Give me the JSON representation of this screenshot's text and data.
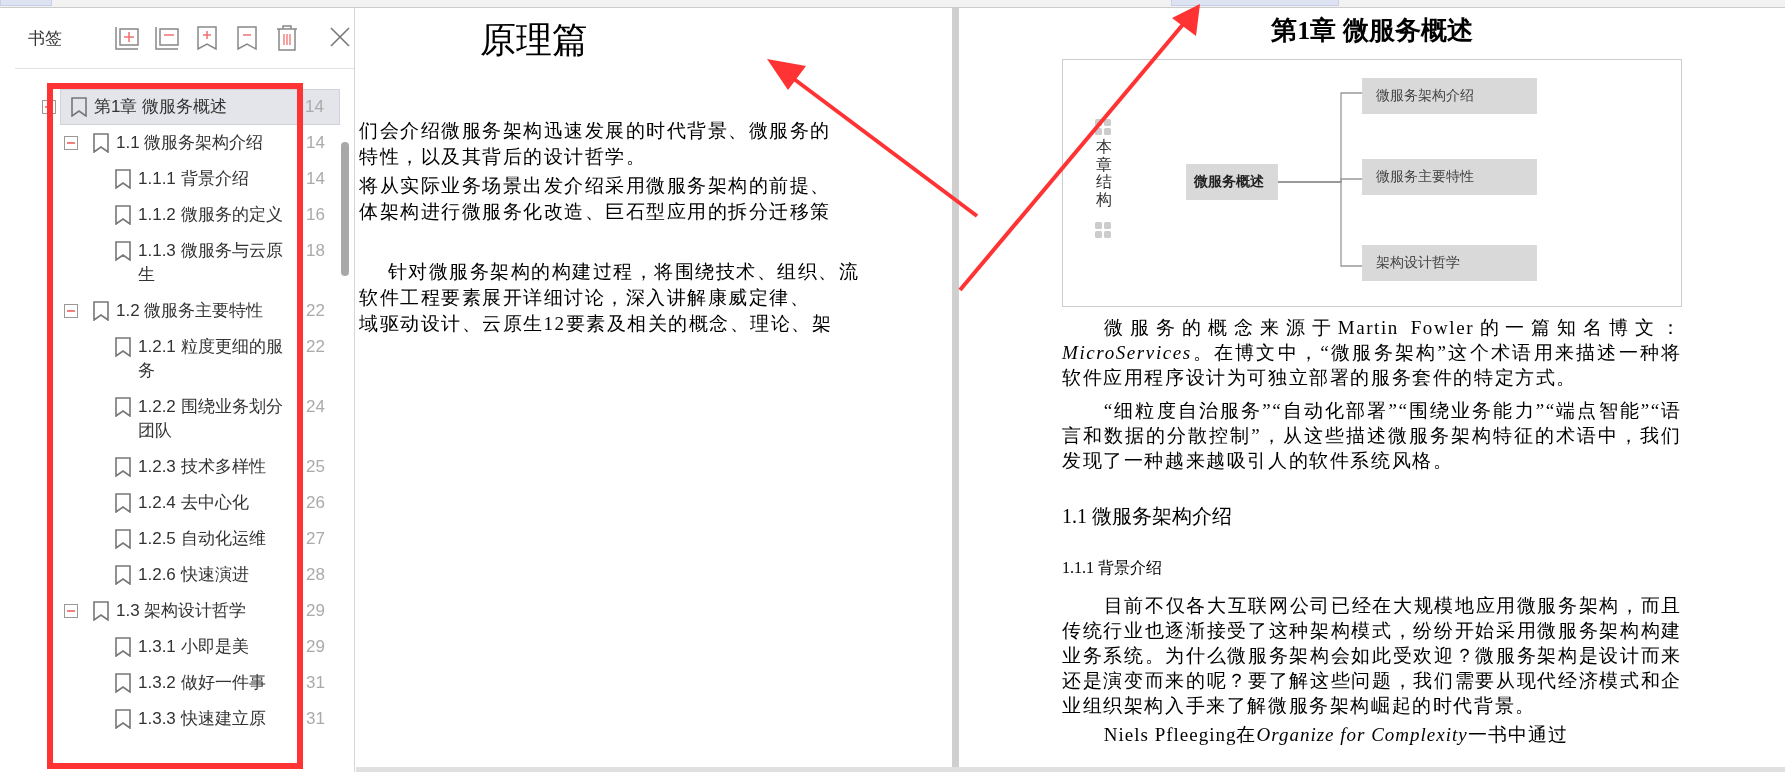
{
  "sidebar": {
    "title": "书签",
    "bookmarks": [
      {
        "label": "第1章 微服务概述",
        "page": "14",
        "selected": true,
        "expanded": true,
        "children": [
          {
            "label": "1.1 微服务架构介绍",
            "page": "14",
            "selected": false,
            "expanded": true,
            "children": [
              {
                "label": "1.1.1 背景介绍",
                "page": "14",
                "selected": false
              },
              {
                "label": "1.1.2 微服务的定义",
                "page": "16",
                "selected": false
              },
              {
                "label": "1.1.3 微服务与云原生",
                "page": "18",
                "selected": false
              }
            ]
          },
          {
            "label": "1.2 微服务主要特性",
            "page": "22",
            "selected": false,
            "expanded": true,
            "children": [
              {
                "label": "1.2.1 粒度更细的服务",
                "page": "22",
                "selected": false
              },
              {
                "label": "1.2.2 围绕业务划分团队",
                "page": "24",
                "selected": false
              },
              {
                "label": "1.2.3 技术多样性",
                "page": "25",
                "selected": false
              },
              {
                "label": "1.2.4 去中心化",
                "page": "26",
                "selected": false
              },
              {
                "label": "1.2.5 自动化运维",
                "page": "27",
                "selected": false
              },
              {
                "label": "1.2.6 快速演进",
                "page": "28",
                "selected": false
              }
            ]
          },
          {
            "label": "1.3 架构设计哲学",
            "page": "29",
            "selected": false,
            "expanded": true,
            "children": [
              {
                "label": "1.3.1 小即是美",
                "page": "29",
                "selected": false
              },
              {
                "label": "1.3.2 做好一件事",
                "page": "31",
                "selected": false
              },
              {
                "label": "1.3.3 快速建立原",
                "page": "31",
                "selected": false
              }
            ]
          }
        ]
      }
    ]
  },
  "left_page": {
    "title": "原理篇",
    "paragraphs": [
      {
        "lines": [
          "们会介绍微服务架构迅速发展的时代背景、微服务的",
          "特性，以及其背后的设计哲学。"
        ]
      },
      {
        "lines": [
          "将从实际业务场景出发介绍采用微服务架构的前提、",
          "体架构进行微服务化改造、巨石型应用的拆分迁移策"
        ]
      },
      {
        "lines": [
          "针对微服务架构的构建过程，将围绕技术、组织、流",
          "软件工程要素展开详细讨论，深入讲解康威定律、",
          "域驱动设计、云原生12要素及相关的概念、理论、架"
        ]
      }
    ]
  },
  "right_page": {
    "title": "第1章  微服务概述",
    "diagram": {
      "side_label": "本章结构",
      "center": "微服务概述",
      "branches": [
        "微服务架构介绍",
        "微服务主要特性",
        "架构设计哲学"
      ]
    },
    "blocks": [
      {
        "kind": "paragraph",
        "text": "微服务的概念来源于Martin Fowler的一篇知名博文：*MicroServices*。在博文中，“微服务架构”这个术语用来描述一种将软件应用程序设计为可独立部署的服务套件的特定方式。"
      },
      {
        "kind": "paragraph",
        "text": "“细粒度自治服务”“自动化部署”“围绕业务能力”“端点智能”“语言和数据的分散控制”，从这些描述微服务架构特征的术语中，我们发现了一种越来越吸引人的软件系统风格。"
      },
      {
        "kind": "heading",
        "text": "1.1 微服务架构介绍"
      },
      {
        "kind": "subheading",
        "text": "1.1.1 背景介绍"
      },
      {
        "kind": "paragraph",
        "text": "目前不仅各大互联网公司已经在大规模地应用微服务架构，而且传统行业也逐渐接受了这种架构模式，纷纷开始采用微服务架构构建业务系统。为什么微服务架构会如此受欢迎？微服务架构是设计而来还是演变而来的呢？要了解这些问题，我们需要从现代经济模式和企业组织架构入手来了解微服务架构崛起的时代背景。"
      },
      {
        "kind": "cutline",
        "before": "Niels Pfleeging在",
        "title": "Organize for Complexity",
        "after": "一书中通过"
      }
    ]
  }
}
